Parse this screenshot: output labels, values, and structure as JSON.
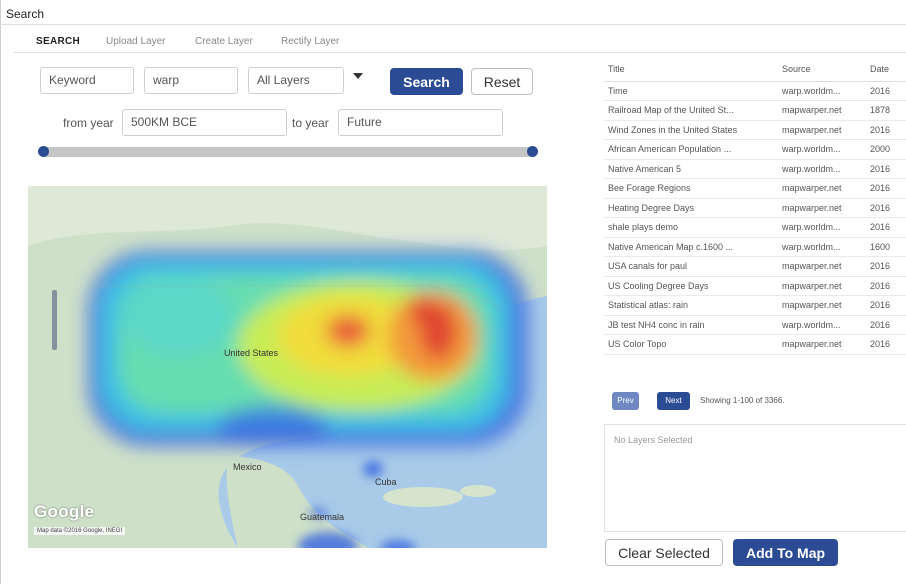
{
  "panel": {
    "title": "Search"
  },
  "tabs": [
    {
      "label": "SEARCH",
      "active": true
    },
    {
      "label": "Upload Layer",
      "active": false
    },
    {
      "label": "Create Layer",
      "active": false
    },
    {
      "label": "Rectify Layer",
      "active": false
    }
  ],
  "search": {
    "field_label": "Keyword",
    "query": "warp",
    "layer_filter": "All Layers",
    "search_button": "Search",
    "reset_button": "Reset"
  },
  "year_filter": {
    "from_label": "from year",
    "from_value": "500KM BCE",
    "to_label": "to year",
    "to_value": "Future"
  },
  "map": {
    "logo": "Google",
    "attribution": "Map data ©2016 Google, INEGI",
    "places": [
      "United States",
      "Mexico",
      "Cuba",
      "Guatemala"
    ]
  },
  "results": {
    "columns": [
      "Title",
      "Source",
      "Date"
    ],
    "rows": [
      {
        "title": "Time",
        "source": "warp.worldm...",
        "date": "2016"
      },
      {
        "title": "Railroad Map of the United St...",
        "source": "mapwarper.net",
        "date": "1878"
      },
      {
        "title": "Wind Zones in the United States",
        "source": "mapwarper.net",
        "date": "2016"
      },
      {
        "title": "African American Population ...",
        "source": "warp.worldm...",
        "date": "2000"
      },
      {
        "title": "Native American 5",
        "source": "warp.worldm...",
        "date": "2016"
      },
      {
        "title": "Bee Forage Regions",
        "source": "mapwarper.net",
        "date": "2016"
      },
      {
        "title": "Heating Degree Days",
        "source": "mapwarper.net",
        "date": "2016"
      },
      {
        "title": "shale plays demo",
        "source": "warp.worldm...",
        "date": "2016"
      },
      {
        "title": "Native American Map c.1600 ...",
        "source": "warp.worldm...",
        "date": "1600"
      },
      {
        "title": "USA canals for paul",
        "source": "mapwarper.net",
        "date": "2016"
      },
      {
        "title": "US Cooling Degree Days",
        "source": "mapwarper.net",
        "date": "2016"
      },
      {
        "title": "Statistical atlas: rain",
        "source": "mapwarper.net",
        "date": "2016"
      },
      {
        "title": "JB test NH4 conc in rain",
        "source": "warp.worldm...",
        "date": "2016"
      },
      {
        "title": "US Color Topo",
        "source": "mapwarper.net",
        "date": "2016"
      }
    ],
    "prev_label": "Prev",
    "next_label": "Next",
    "showing": "Showing 1-100 of 3366."
  },
  "selection": {
    "empty_text": "No Layers Selected",
    "clear_button": "Clear Selected",
    "add_button": "Add To Map"
  },
  "colors": {
    "accent": "#2c4b95",
    "prev_button": "#6f88c2"
  }
}
